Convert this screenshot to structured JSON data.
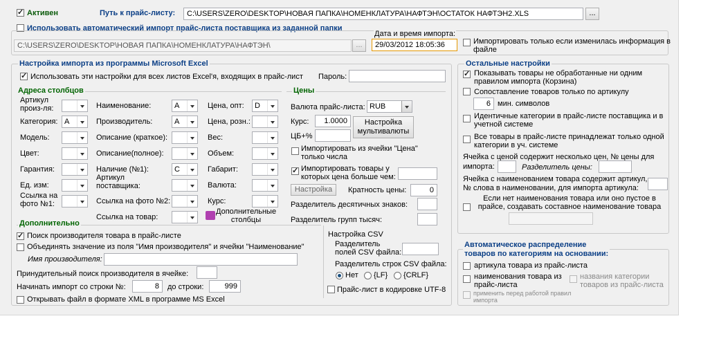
{
  "top": {
    "active_label": "Активен",
    "price_path_label": "Путь к прайс-листу:",
    "price_path_value": "C:\\USERS\\ZERO\\DESKTOP\\НОВАЯ ПАПКА\\НОМЕНКЛАТУРА\\НАФТЭН\\ОСТАТОК НАФТЭН2.XLS",
    "browse": "...",
    "auto_import_label": "Использовать автоматический импорт прайс-листа поставщика из заданной папки",
    "folder_value": "C:\\USERS\\ZERO\\DESKTOP\\НОВАЯ ПАПКА\\НОМЕНКЛАТУРА\\НАФТЭН\\",
    "datetime_label": "Дата и время импорта:",
    "datetime_value": "29/03/2012 18:05:36",
    "only_changed_label": "Импортировать только если изменилась информация в файле"
  },
  "excel": {
    "title": "Настройка импорта из программы Microsoft Excel",
    "use_all_sheets": "Использовать эти настройки для всех листов Excel'я, входящих в прайс-лист",
    "password_label": "Пароль:"
  },
  "columns": {
    "title": "Адреса столбцов",
    "left": [
      {
        "label1": "Артикул",
        "label2": "произ-ля:",
        "value": ""
      },
      {
        "label1": "Категория:",
        "label2": "",
        "value": "A"
      },
      {
        "label1": "Модель:",
        "label2": "",
        "value": ""
      },
      {
        "label1": "Цвет:",
        "label2": "",
        "value": ""
      },
      {
        "label1": "Гарантия:",
        "label2": "",
        "value": ""
      },
      {
        "label1": "Ед. изм:",
        "label2": "",
        "value": ""
      },
      {
        "label1": "Ссылка на",
        "label2": "фото №1:",
        "value": ""
      }
    ],
    "mid": [
      {
        "label1": "Наименование:",
        "label2": "",
        "value": "A"
      },
      {
        "label1": "Производитель:",
        "label2": "",
        "value": "A"
      },
      {
        "label1": "Описание (краткое):",
        "label2": "",
        "value": ""
      },
      {
        "label1": "Описание(полное):",
        "label2": "",
        "value": ""
      },
      {
        "label1": "Наличие (№1):",
        "label2": "",
        "value": "C"
      },
      {
        "label1": "Артикул",
        "label2": "поставщика:",
        "value": ""
      },
      {
        "label1": "Ссылка на фото №2:",
        "label2": "",
        "value": ""
      },
      {
        "label1": "Ссылка на товар:",
        "label2": "",
        "value": ""
      }
    ],
    "right": [
      {
        "label1": "Цена, опт:",
        "value": "D"
      },
      {
        "label1": "Цена, розн.:",
        "value": ""
      },
      {
        "label1": "Вес:",
        "value": ""
      },
      {
        "label1": "Объем:",
        "value": ""
      },
      {
        "label1": "Габарит:",
        "value": ""
      },
      {
        "label1": "Валюта:",
        "value": ""
      },
      {
        "label1": "Курс:",
        "value": ""
      }
    ],
    "more_columns1": "Дополнительные",
    "more_columns2": "столбцы"
  },
  "prices": {
    "title": "Цены",
    "currency_label": "Валюта прайс-листа:",
    "currency_value": "RUB",
    "rate_label": "Курс:",
    "rate_value": "1.0000",
    "multicurrency1": "Настройка",
    "multicurrency2": "мультивалюты",
    "cb_label": "ЦБ+%",
    "import_from_price": "Импортировать из ячейки \"Цена\" только числа",
    "import_greater": "Импортировать товары у которых цена больше чем:",
    "setup_btn": "Настройка",
    "multiplicity_label": "Кратность цены:",
    "multiplicity_value": "0",
    "decimal_sep": "Разделитель десятичных знаков:",
    "group_sep": "Разделитель групп тысяч:"
  },
  "extra": {
    "title": "Дополнительно",
    "search_maker": "Поиск производителя товара в прайс-листе",
    "combine_values": "Объединять значение из поля \"Имя производителя\" и ячейки \"Наименование\"",
    "maker_name_label": "Имя производителя:",
    "forced_search": "Принудительный поиск производителя в ячейке:",
    "start_row_label": "Начинать импорт со строки №:",
    "start_row_value": "8",
    "to_row_label": "до строки:",
    "to_row_value": "999",
    "open_xml": "Открывать файл в формате XML в программе MS Excel"
  },
  "csv": {
    "title": "Настройка CSV",
    "field_sep1": "Разделитель",
    "field_sep2": "полей CSV файла:",
    "row_sep": "Разделитель строк CSV файла:",
    "opt_none": "Нет",
    "opt_lf": "{LF}",
    "opt_crlf": "{CRLF}",
    "utf8": "Прайс-лист в кодировке UTF-8"
  },
  "other": {
    "title": "Остальные настройки",
    "show_unprocessed": "Показывать товары не обработанные ни одним правилом импорта (Корзина)",
    "match_article": "Сопоставление товаров только по артикулу",
    "min_symbols_value": "6",
    "min_symbols_label": "мин. символов",
    "identical_categories": "Идентичные категории в прайс-листе поставщика и в учетной системе",
    "one_category": "Все товары в прайс-листе принадлежат только одной категории в уч. системе",
    "several_prices1": "Ячейка с ценой содержит несколько цен, № цены для",
    "several_prices2": "импорта:",
    "price_sep_label": "Разделитель цены:",
    "name_has_article1": "Ячейка с наименованием товара содержит артикул,",
    "name_has_article2": "№ слова в наименовании, для импорта артикула:",
    "composite_name": "Если нет наименования товара или оно пустое в прайсе, создавать составное наименование товара из ячеек:"
  },
  "autodist": {
    "title1": "Автоматическое распределение",
    "title2": "товаров по категориям на основании:",
    "by_article": "артикула товара из прайс-листа",
    "by_name": "наименования товара из прайс-листа",
    "by_category_names": "названия категории товаров из прайс-листа",
    "apply_rules": "применить перед работой правил импорта"
  }
}
